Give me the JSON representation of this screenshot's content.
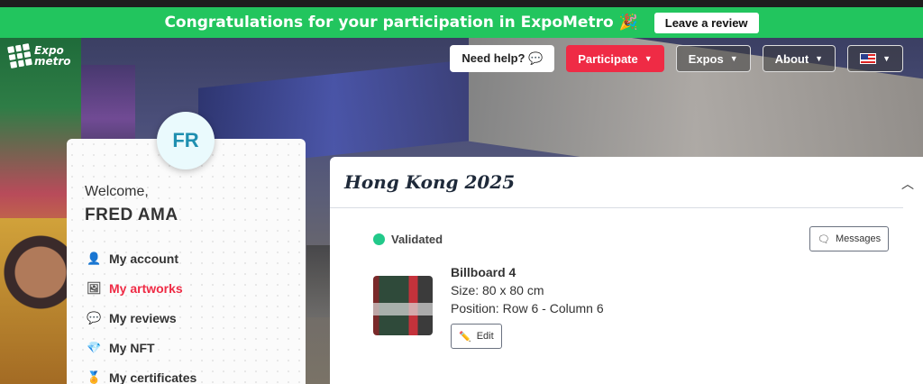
{
  "banner": {
    "message": "Congratulations for your participation in ExpoMetro 🎉",
    "review_label": "Leave a review",
    "color": "#22c55e"
  },
  "logo": {
    "line1": "Expo",
    "line2": "metro"
  },
  "nav": {
    "help_label": "Need help? 💬",
    "participate_label": "Participate",
    "expos_label": "Expos",
    "about_label": "About",
    "language_icon": "us-flag-icon",
    "accent": "#ef2b45"
  },
  "profile": {
    "initials": "FR",
    "welcome": "Welcome,",
    "name": "FRED AMA"
  },
  "sidebar": {
    "items": [
      {
        "label": "My account",
        "icon": "user-icon",
        "active": false
      },
      {
        "label": "My artworks",
        "icon": "image-icon",
        "active": true
      },
      {
        "label": "My reviews",
        "icon": "comment-icon",
        "active": false
      },
      {
        "label": "My NFT",
        "icon": "diamond-icon",
        "active": false
      },
      {
        "label": "My certificates",
        "icon": "certificate-icon",
        "active": false
      }
    ]
  },
  "expo": {
    "title": "Hong Kong 2025",
    "status": "Validated",
    "status_color": "#22c98a",
    "messages_label": "Messages",
    "billboard": {
      "name": "Billboard 4",
      "size": "Size: 80 x 80 cm",
      "position": "Position: Row 6 - Column 6",
      "edit_label": "Edit"
    }
  }
}
